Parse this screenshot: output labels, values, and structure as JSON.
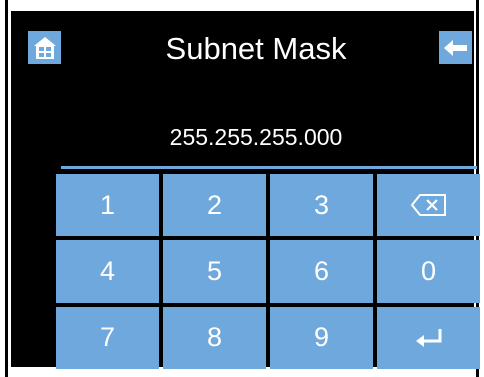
{
  "header": {
    "title": "Subnet Mask",
    "home_icon": "home-icon",
    "back_icon": "arrow-left-icon"
  },
  "display": {
    "value": "255.255.255.000"
  },
  "keypad": {
    "keys": [
      {
        "label": "1",
        "type": "digit"
      },
      {
        "label": "2",
        "type": "digit"
      },
      {
        "label": "3",
        "type": "digit"
      },
      {
        "label": "",
        "type": "backspace",
        "icon": "backspace-icon"
      },
      {
        "label": "4",
        "type": "digit"
      },
      {
        "label": "5",
        "type": "digit"
      },
      {
        "label": "6",
        "type": "digit"
      },
      {
        "label": "0",
        "type": "digit"
      },
      {
        "label": "7",
        "type": "digit"
      },
      {
        "label": "8",
        "type": "digit"
      },
      {
        "label": "9",
        "type": "digit"
      },
      {
        "label": "",
        "type": "enter",
        "icon": "enter-icon"
      }
    ]
  },
  "colors": {
    "background": "#000000",
    "accent": "#6fa8dc",
    "text": "#ffffff"
  }
}
